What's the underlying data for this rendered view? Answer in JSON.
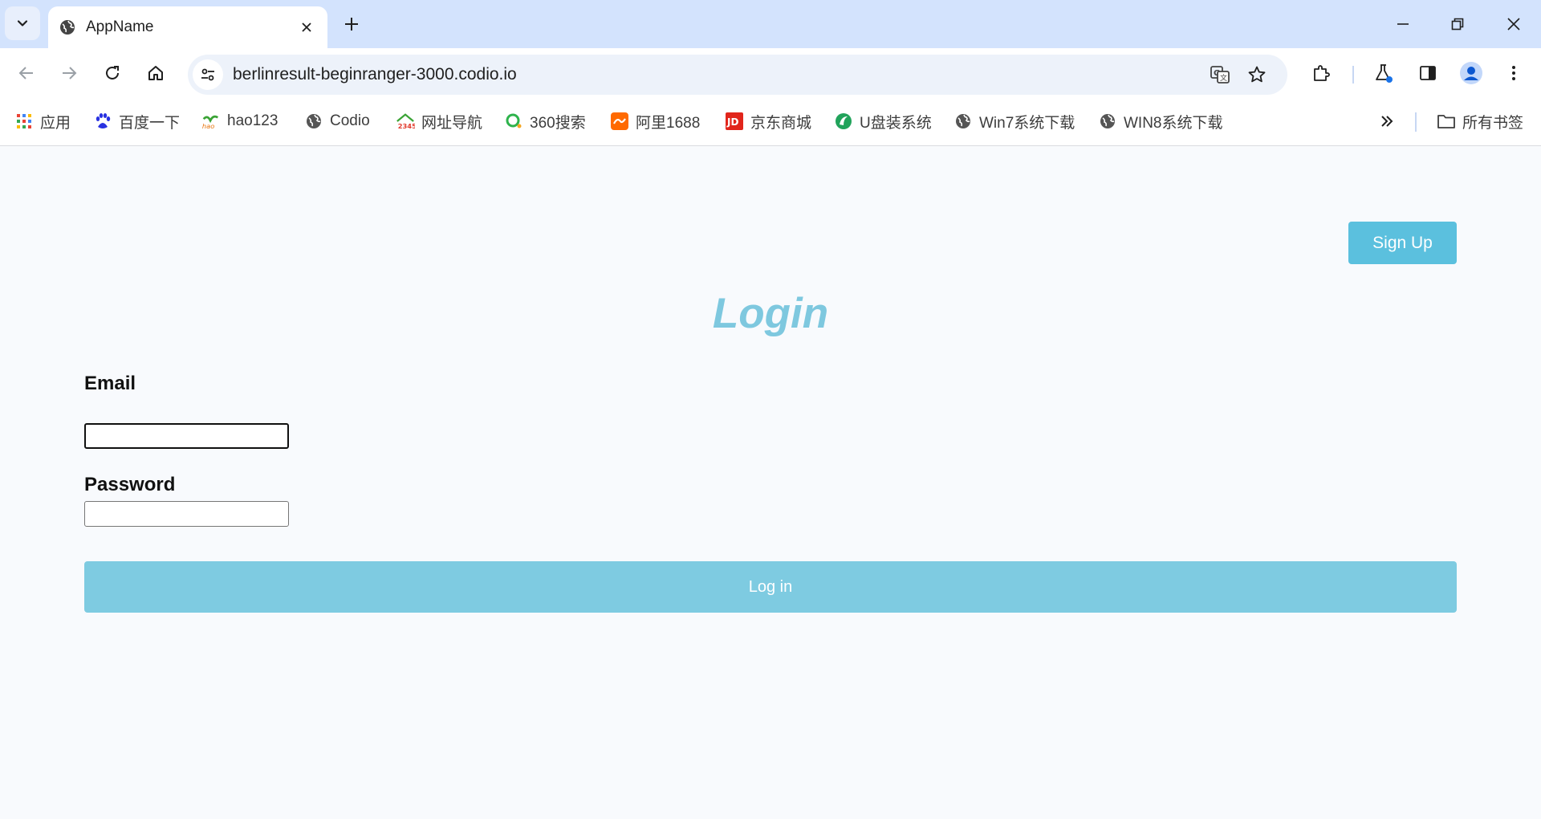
{
  "browser": {
    "tab": {
      "title": "AppName",
      "icon": "globe-icon"
    },
    "window_controls": [
      "minimize",
      "restore",
      "close"
    ],
    "address_bar": {
      "url": "berlinresult-beginranger-3000.codio.io"
    },
    "bookmarks": [
      {
        "label": "应用",
        "icon": "apps-grid-icon"
      },
      {
        "label": "百度一下",
        "icon": "baidu-paw-icon"
      },
      {
        "label": "hao123",
        "icon": "hao123-icon"
      },
      {
        "label": "Codio",
        "icon": "globe-icon"
      },
      {
        "label": "网址导航",
        "icon": "2345-icon"
      },
      {
        "label": "360搜索",
        "icon": "360-search-icon"
      },
      {
        "label": "阿里1688",
        "icon": "alibaba-1688-icon"
      },
      {
        "label": "京东商城",
        "icon": "jd-icon"
      },
      {
        "label": "U盘装系统",
        "icon": "usb-system-icon"
      },
      {
        "label": "Win7系统下载",
        "icon": "globe-icon"
      },
      {
        "label": "WIN8系统下载",
        "icon": "globe-icon"
      }
    ],
    "all_bookmarks_label": "所有书签"
  },
  "page": {
    "signup_label": "Sign Up",
    "title": "Login",
    "email_label": "Email",
    "email_value": "",
    "password_label": "Password",
    "password_value": "",
    "login_label": "Log in"
  },
  "colors": {
    "accent": "#5bc0de",
    "title": "#7ec8df",
    "login_button": "#7ecbe1",
    "tabstrip": "#d3e3fd"
  }
}
